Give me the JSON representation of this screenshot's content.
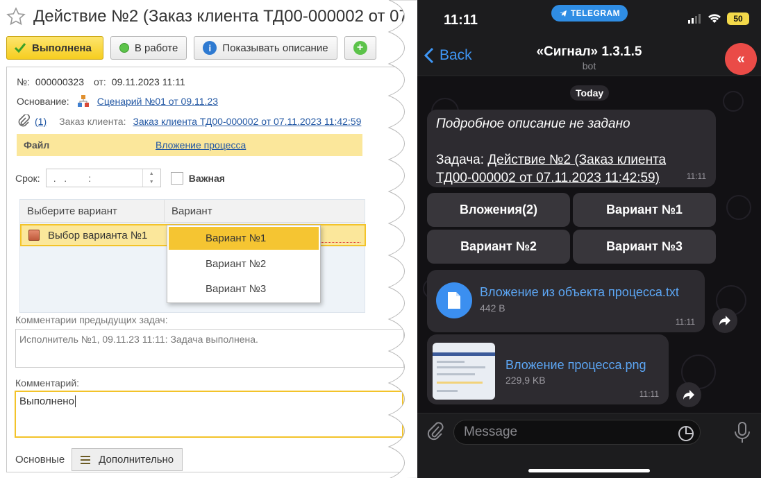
{
  "left": {
    "title": "Действие №2 (Заказ клиента ТД00-000002 от 07.",
    "toolbar": {
      "done": "Выполнена",
      "in_work": "В работе",
      "show_description": "Показывать описание"
    },
    "number_label": "№:",
    "number_value": "000000323",
    "date_label": "от:",
    "date_value": "09.11.2023 11:11",
    "basis_label": "Основание:",
    "basis_link": "Сценарий №01 от 09.11.23",
    "attach_count": "(1)",
    "order_label": "Заказ клиента:",
    "order_link": "Заказ клиента ТД00-000002 от 07.11.2023 11:42:59",
    "file_label": "Файл",
    "file_link": "Вложение процесса",
    "term_label": "Срок:",
    "term_value": ".   .        :",
    "important_label": "Важная",
    "grid": {
      "col1": "Выберите вариант",
      "col2": "Вариант",
      "row_label": "Выбор варианта №1"
    },
    "dropdown": [
      "Вариант №1",
      "Вариант №2",
      "Вариант №3"
    ],
    "prev_comments_label": "Комментарии предыдущих задач:",
    "prev_comments_value": "Исполнитель №1, 09.11.23 11:11: Задача выполнена.",
    "comment_label": "Комментарий:",
    "comment_value": "Выполнено",
    "tabs": {
      "main": "Основные",
      "additional": "Дополнительно"
    }
  },
  "right": {
    "time": "11:11",
    "telegram_pill": "TELEGRAM",
    "battery": "50",
    "back": "Back",
    "chat_title": "«Сигнал» 1.3.1.5",
    "chat_subtitle": "bot",
    "avatar": "«",
    "date_badge": "Today",
    "message": {
      "line1": "Подробное описание не задано",
      "task_label": "Задача:",
      "task_link_1": "Действие №2 (Заказ клиента",
      "task_link_2": "ТД00-000002 от 07.11.2023 11:42:59)",
      "time": "11:11"
    },
    "keyboard": [
      "Вложения(2)",
      "Вариант №1",
      "Вариант №2",
      "Вариант №3"
    ],
    "file1": {
      "name": "Вложение из объекта процесса.txt",
      "size": "442 B",
      "time": "11:11"
    },
    "file2": {
      "name": "Вложение процесса.png",
      "size": "229,9 KB",
      "time": "11:11"
    },
    "input_placeholder": "Message",
    "accent": "#3f97f6"
  }
}
